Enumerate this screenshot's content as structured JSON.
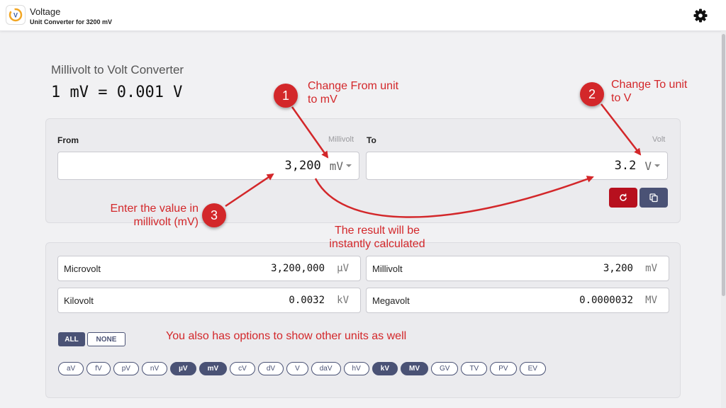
{
  "header": {
    "app_name": "Voltage",
    "subtitle": "Unit Converter for 3200 mV"
  },
  "page": {
    "title": "Millivolt to Volt Converter",
    "formula": "1 mV = 0.001 V"
  },
  "from": {
    "label": "From",
    "unit_name": "Millivolt",
    "value": "3,200",
    "unit": "mV"
  },
  "to": {
    "label": "To",
    "unit_name": "Volt",
    "value": "3.2",
    "unit": "V"
  },
  "actions": {
    "reset_color": "#b7101e",
    "copy_color": "#4a5275"
  },
  "results": [
    {
      "name": "Microvolt",
      "value": "3,200,000",
      "unit": "µV"
    },
    {
      "name": "Millivolt",
      "value": "3,200",
      "unit": "mV"
    },
    {
      "name": "Kilovolt",
      "value": "0.0032",
      "unit": "kV"
    },
    {
      "name": "Megavolt",
      "value": "0.0000032",
      "unit": "MV"
    }
  ],
  "toggles": {
    "all": "ALL",
    "none": "NONE"
  },
  "chips": [
    {
      "label": "aV",
      "on": false
    },
    {
      "label": "fV",
      "on": false
    },
    {
      "label": "pV",
      "on": false
    },
    {
      "label": "nV",
      "on": false
    },
    {
      "label": "µV",
      "on": true
    },
    {
      "label": "mV",
      "on": true
    },
    {
      "label": "cV",
      "on": false
    },
    {
      "label": "dV",
      "on": false
    },
    {
      "label": "V",
      "on": false
    },
    {
      "label": "daV",
      "on": false
    },
    {
      "label": "hV",
      "on": false
    },
    {
      "label": "kV",
      "on": true
    },
    {
      "label": "MV",
      "on": true
    },
    {
      "label": "GV",
      "on": false
    },
    {
      "label": "TV",
      "on": false
    },
    {
      "label": "PV",
      "on": false
    },
    {
      "label": "EV",
      "on": false
    }
  ],
  "annotations": {
    "step1_num": "1",
    "step1_line1": "Change From unit",
    "step1_line2": "to mV",
    "step2_num": "2",
    "step2_line1": "Change To unit",
    "step2_line2": "to V",
    "step3_num": "3",
    "step3_line1": "Enter the value in",
    "step3_line2": "millivolt (mV)",
    "result_line1": "The result will be",
    "result_line2": "instantly calculated",
    "options_text": "You also has options to show other units as well",
    "color": "#d3272a"
  },
  "icons": {
    "logo": "voltage-logo-icon",
    "settings": "gear-icon",
    "reset": "refresh-icon",
    "copy": "copy-icon"
  }
}
